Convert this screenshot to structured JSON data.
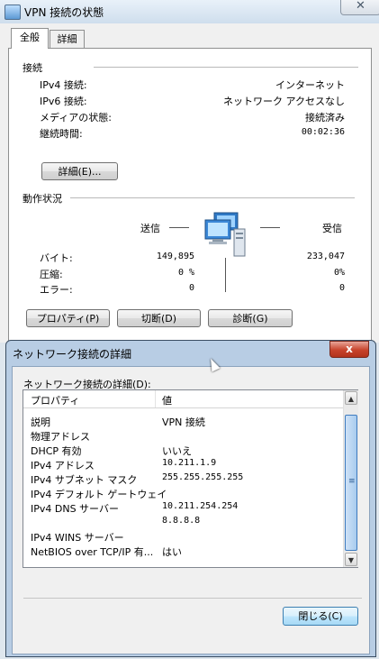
{
  "status_window": {
    "title": "VPN 接続の状態",
    "close_glyph": "✕",
    "tabs": [
      "全般",
      "詳細"
    ],
    "connection": {
      "heading": "接続",
      "rows": [
        {
          "label": "IPv4 接続:",
          "value": "インターネット"
        },
        {
          "label": "IPv6 接続:",
          "value": "ネットワーク アクセスなし"
        },
        {
          "label": "メディアの状態:",
          "value": "接続済み"
        },
        {
          "label": "継続時間:",
          "value": "00:02:36"
        }
      ],
      "details_button": "詳細(E)..."
    },
    "activity": {
      "heading": "動作状況",
      "sent_label": "送信",
      "received_label": "受信",
      "rows": [
        {
          "label": "バイト:",
          "sent": "149,895",
          "received": "233,047"
        },
        {
          "label": "圧縮:",
          "sent": "0 %",
          "received": "0%"
        },
        {
          "label": "エラー:",
          "sent": "0",
          "received": "0"
        }
      ]
    },
    "buttons": {
      "properties": "プロパティ(P)",
      "disconnect": "切断(D)",
      "diagnose": "診断(G)"
    }
  },
  "details_dialog": {
    "title": "ネットワーク接続の詳細",
    "close_glyph": "x",
    "list_label": "ネットワーク接続の詳細(D):",
    "columns": [
      "プロパティ",
      "値"
    ],
    "rows": [
      {
        "property": "説明",
        "value": "VPN 接続"
      },
      {
        "property": "物理アドレス",
        "value": ""
      },
      {
        "property": "DHCP 有効",
        "value": "いいえ"
      },
      {
        "property": "IPv4 アドレス",
        "value": "10.211.1.9"
      },
      {
        "property": "IPv4 サブネット マスク",
        "value": "255.255.255.255"
      },
      {
        "property": "IPv4 デフォルト ゲートウェイ",
        "value": ""
      },
      {
        "property": "IPv4 DNS サーバー",
        "value": "10.211.254.254"
      },
      {
        "property": "",
        "value": "8.8.8.8"
      },
      {
        "property": "IPv4 WINS サーバー",
        "value": ""
      },
      {
        "property": "NetBIOS over TCP/IP 有...",
        "value": "はい"
      }
    ],
    "close_button": "閉じる(C)",
    "scroll_up": "▲",
    "scroll_down": "▼",
    "scroll_grip": "≡"
  }
}
